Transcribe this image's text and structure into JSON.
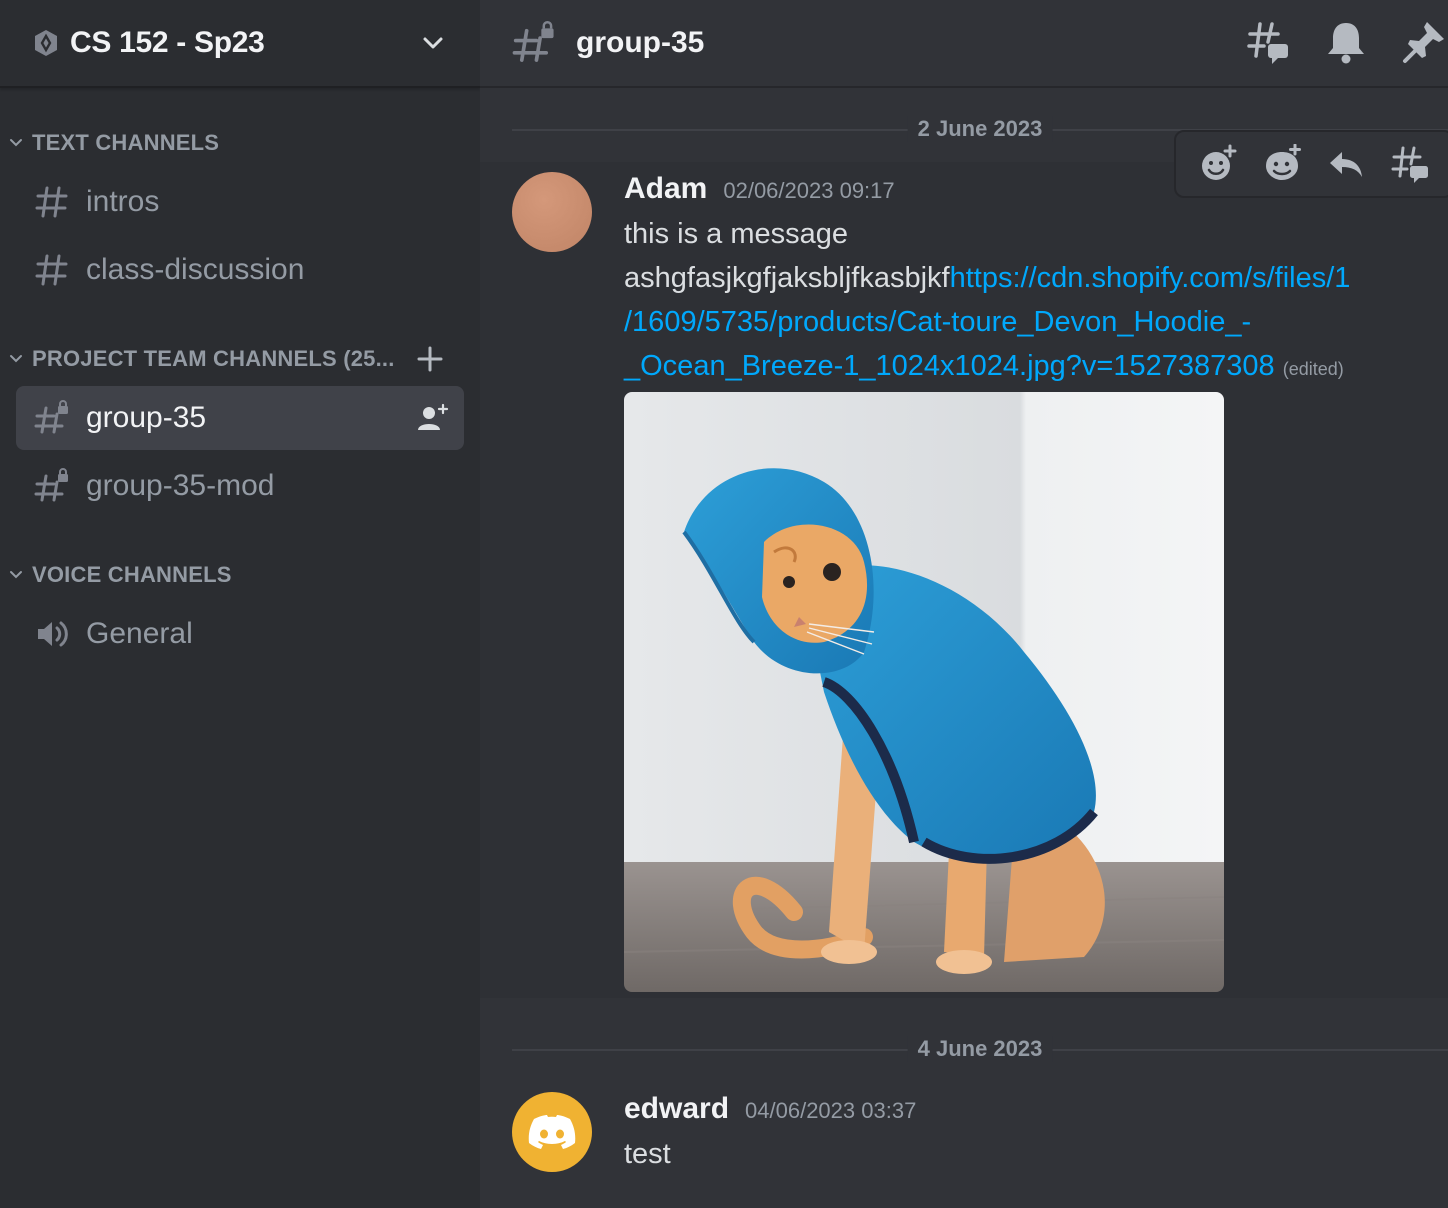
{
  "server": {
    "name": "CS 152 - Sp23"
  },
  "categories": {
    "text": "TEXT CHANNELS",
    "project": "PROJECT TEAM CHANNELS (25...",
    "voice": "VOICE CHANNELS"
  },
  "channels": {
    "intros": "intros",
    "class_discussion": "class-discussion",
    "group_35": "group-35",
    "group_35_mod": "group-35-mod",
    "general": "General"
  },
  "header": {
    "channel": "group-35"
  },
  "dates": {
    "first": "2 June 2023",
    "second": "4 June 2023"
  },
  "messages": [
    {
      "author": "Adam",
      "time": "02/06/2023 09:17",
      "line1": "this is a message",
      "line2_text": "ashgfasjkgfjaksbljfkasbjkf",
      "link_part1": "https://cdn.shopify.com/s/files/1",
      "link_part2": "/1609/5735/products/Cat-toure_Devon_Hoodie_-",
      "link_part3": "_Ocean_Breeze-1_1024x1024.jpg?v=1527387308",
      "edited": "(edited)"
    },
    {
      "author": "edward",
      "time": "04/06/2023 03:37",
      "text": "test"
    }
  ],
  "colors": {
    "accent_link": "#00a8fc",
    "adam_avatar": "#c98a6a",
    "edward_avatar": "#f0b232",
    "sidebar_bg": "#2b2d31",
    "main_bg": "#313338"
  }
}
